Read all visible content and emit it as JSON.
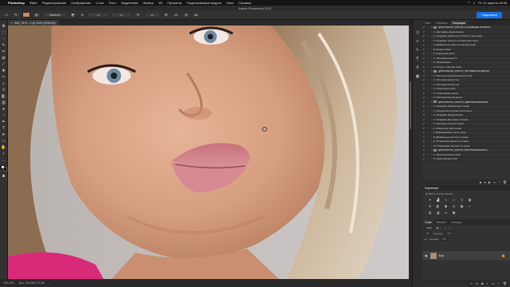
{
  "menubar": {
    "app": "Photoshop",
    "items": [
      "Файл",
      "Редактирование",
      "Изображение",
      "Слои",
      "Текст",
      "Выделение",
      "Фильтр",
      "3D",
      "Просмотр",
      "Подключаемые модули",
      "Окно",
      "Справка"
    ],
    "clock": "Пт 21 апреля 18:38"
  },
  "window": {
    "title": "Adobe Photoshop 2022"
  },
  "options": {
    "mode_label": "Замена",
    "share_label": "Поделиться"
  },
  "document": {
    "tab": "IMG_3472 - 4 @ 200% (RGB/16)"
  },
  "status": {
    "zoom": "200,24%",
    "info": "Док: 104,9M/170,2M"
  },
  "panels": {
    "tabs": [
      "Цвет",
      "Образцы",
      "Операции"
    ],
    "active_tab": "Операции",
    "adjustments": {
      "title": "Коррекция",
      "subtitle": "Добавить корректировку"
    },
    "layers": {
      "tabs": [
        "Слои",
        "Каналы",
        "Контуры"
      ],
      "kind_label": "Вид",
      "opacity_label": "Непрозр.",
      "fill_label": "Заливка",
      "layer_name": "Фон"
    }
  },
  "actions": [
    {
      "label": "@NASTROVA_PHOTO_ОСНОВНЫЕ ЭТАПЫ Р",
      "type": "set"
    },
    {
      "label": "1. Настройка размножения",
      "type": "action"
    },
    {
      "label": "2. Создание дефектов в области тона лица",
      "type": "action"
    },
    {
      "label": "3. Создание черного отливка кожи лица",
      "type": "action"
    },
    {
      "label": "4. Добавление шума на текстуру кожи",
      "type": "action"
    },
    {
      "label": "5. Dodge & Burn",
      "type": "action"
    },
    {
      "label": "6. Коррекция цвета",
      "type": "action"
    },
    {
      "label": "7. Усиление резкости",
      "type": "action"
    },
    {
      "label": "8. Тонирование",
      "type": "action"
    },
    {
      "label": "9. Ретушь пластики лица",
      "type": "action"
    },
    {
      "label": "@NASTROVA_PHOTO_ПРОРАБОТКА ДЕТАЛ",
      "type": "set"
    },
    {
      "label": "1. Усиление выразительности глаз",
      "type": "action"
    },
    {
      "label": "2. Усиление цвета глаз",
      "type": "action"
    },
    {
      "label": "3. Усиление блеска губ",
      "type": "action"
    },
    {
      "label": "4. Осветление кожи",
      "type": "action"
    },
    {
      "label": "5. Отбеливание зубов",
      "type": "action"
    },
    {
      "label": "6. Усиление блеска волос",
      "type": "action"
    },
    {
      "label": "@NASTROVA_PHOTO_ЦВЕТОКОРРЕКЦИЯ",
      "type": "set"
    },
    {
      "label": "1. Создание нейтральных теней",
      "type": "action"
    },
    {
      "label": "2. Повышение контрастности фото",
      "type": "action"
    },
    {
      "label": "3. Создание бледной кожи",
      "type": "action"
    },
    {
      "label": "4. Создание бронзового загара",
      "type": "action"
    },
    {
      "label": "5. Усиление сочности фото",
      "type": "action"
    },
    {
      "label": "6. Изменение цвета кожи",
      "type": "action"
    },
    {
      "label": "7. Выравнивание пятен лица",
      "type": "action"
    },
    {
      "label": "8. Добавление желтого оттенка",
      "type": "action"
    },
    {
      "label": "9. Устранение красного оттенка",
      "type": "action"
    },
    {
      "label": "10. Изменение зеленого оттенка",
      "type": "action"
    },
    {
      "label": "@NASTROVA_PHOTO_ВОСПОМИНАНИЯ Н",
      "type": "set"
    },
    {
      "label": "1. Полупрозрачное кожи",
      "type": "action"
    },
    {
      "label": "2. Черно-белый слой",
      "type": "action"
    }
  ],
  "colors": {
    "accent": "#1473e6",
    "panel": "#323232",
    "dark": "#1e1e1e"
  }
}
